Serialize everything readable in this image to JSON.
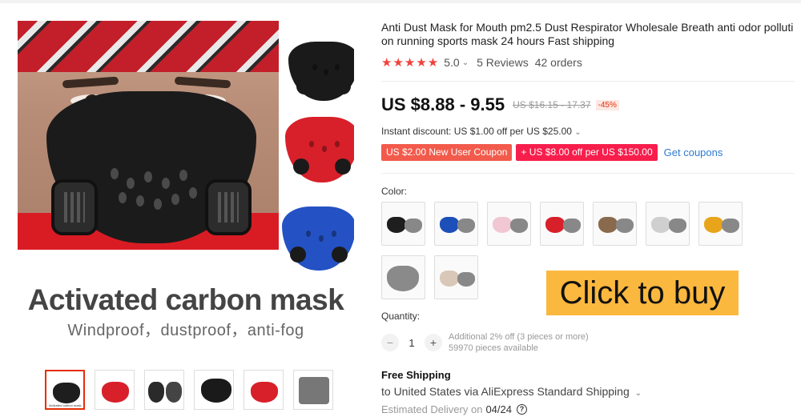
{
  "product": {
    "title": "Anti Dust Mask for Mouth pm2.5 Dust Respirator Wholesale Breath anti odor polluti on running sports mask 24 hours Fast shipping",
    "stars": "★★★★★",
    "rating": "5.0",
    "reviews": "5 Reviews",
    "orders": "42 orders",
    "price": "US $8.88 - 9.55",
    "original_price": "US $16.15 - 17.37",
    "discount": "-45%",
    "instant_discount": "Instant discount: US $1.00 off per US $25.00",
    "coupons": [
      {
        "label": "US $2.00 New User Coupon"
      },
      {
        "label": "+ US $8.00 off per US $150.00"
      }
    ],
    "get_coupons": "Get coupons",
    "color_label": "Color:",
    "colors": [
      {
        "name": "black",
        "hex": "#1e1e1e"
      },
      {
        "name": "blue",
        "hex": "#1d4fb8"
      },
      {
        "name": "pink",
        "hex": "#f0c7d3"
      },
      {
        "name": "red",
        "hex": "#d8202a"
      },
      {
        "name": "camo",
        "hex": "#8a6a4c"
      },
      {
        "name": "white-camo",
        "hex": "#cfcfcf"
      },
      {
        "name": "yellow",
        "hex": "#e8a51b"
      },
      {
        "name": "20pcs",
        "hex": "#8a8a8a"
      },
      {
        "name": "beige-camo",
        "hex": "#d9c8b8"
      }
    ],
    "quantity_label": "Quantity:",
    "quantity": "1",
    "qty_minus": "−",
    "qty_plus": "+",
    "qty_additional": "Additional 2% off (3 pieces or more)",
    "qty_available": "59970 pieces available",
    "shipping_title": "Free Shipping",
    "shipping_to": "to United States via AliExpress Standard Shipping",
    "delivery_label": "Estimated Delivery on",
    "delivery_date": "04/24",
    "help_icon": "?"
  },
  "gallery": {
    "headline": "Activated carbon mask",
    "subline": "Windproof，dustproof，anti-fog",
    "thumb_text": "Activated carbon mask",
    "side_masks": [
      {
        "name": "black",
        "hex": "#1a1a1a"
      },
      {
        "name": "red",
        "hex": "#d8202a"
      },
      {
        "name": "blue",
        "hex": "#2452c4"
      }
    ]
  },
  "promo": {
    "buy_label": "Click to buy",
    "accent": "#fbb83e"
  }
}
